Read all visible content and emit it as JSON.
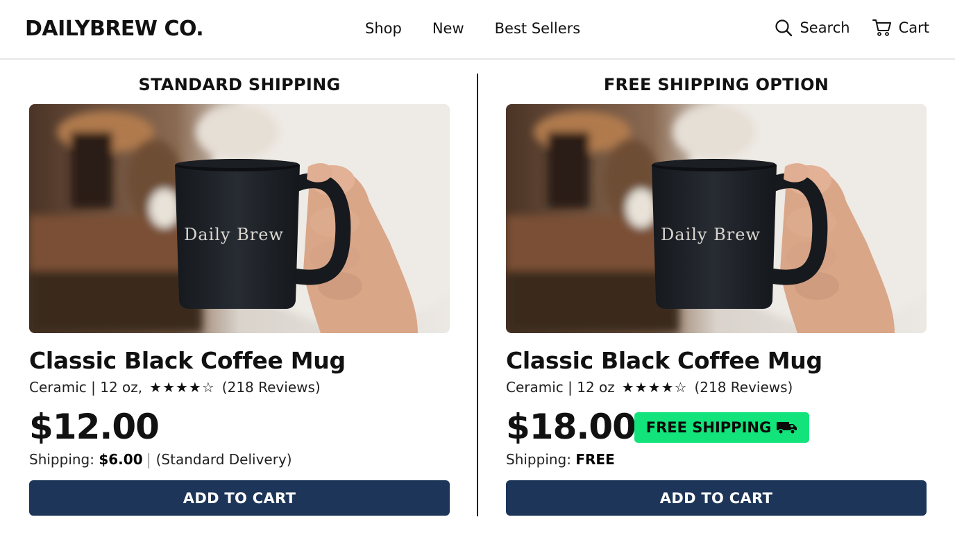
{
  "header": {
    "logo": "DAILYBREW CO.",
    "nav": [
      "Shop",
      "New",
      "Best Sellers"
    ],
    "search_label": "Search",
    "cart_label": "Cart"
  },
  "panels": [
    {
      "title": "STANDARD SHIPPING",
      "mug_text": "Daily Brew",
      "product_name": "Classic Black Coffee Mug",
      "meta": "Ceramic | 12 oz,",
      "stars": "★★★★☆",
      "reviews": "(218 Reviews)",
      "price": "$12.00",
      "shipping_label": "Shipping:",
      "shipping_value": "$6.00",
      "shipping_note": "(Standard Delivery)",
      "button": "ADD TO CART"
    },
    {
      "title": "FREE SHIPPING OPTION",
      "mug_text": "Daily Brew",
      "product_name": "Classic Black Coffee Mug",
      "meta": "Ceramic | 12 oz",
      "stars": "★★★★☆",
      "reviews": "(218 Reviews)",
      "price": "$18.00",
      "badge": "FREE SHIPPING",
      "shipping_label": "Shipping:",
      "shipping_value": "FREE",
      "button": "ADD TO CART"
    }
  ],
  "colors": {
    "button": "#1c3558",
    "badge": "#12e37a",
    "mug": "#1f2329"
  },
  "icons": [
    "search-icon",
    "cart-icon",
    "truck-icon"
  ]
}
